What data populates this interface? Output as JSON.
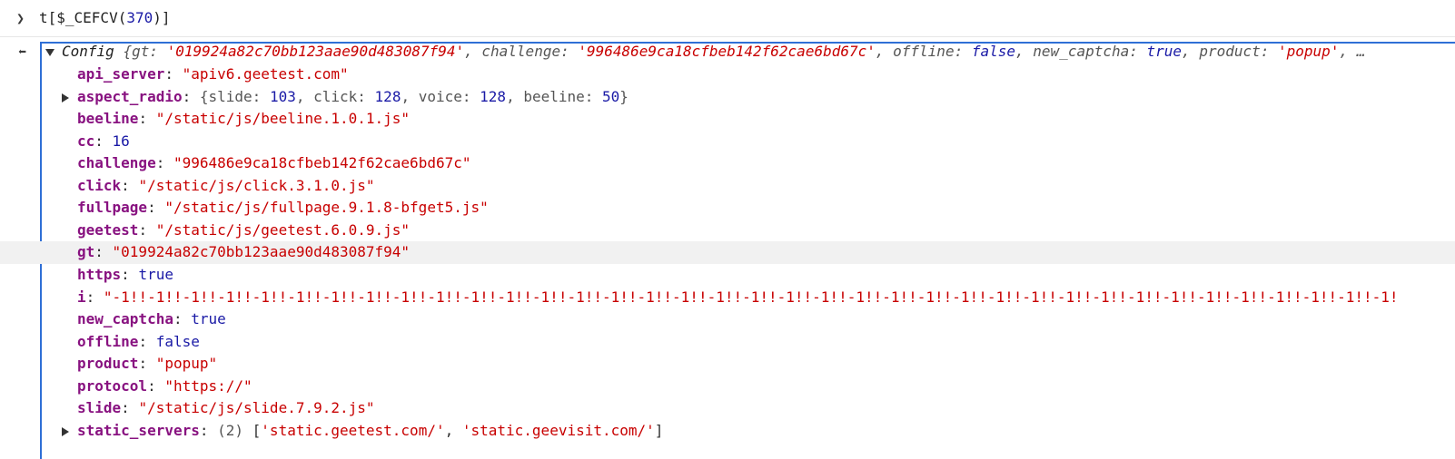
{
  "input": {
    "prompt_icon": "chevron-right-icon",
    "text_pre": "t[$_CEFCV(",
    "num": "370",
    "text_post": ")]"
  },
  "result": {
    "return_icon": "return-arrow-icon",
    "header": {
      "type": "Config",
      "open": "{",
      "gt_key": "gt",
      "gt_val": "'019924a82c70bb123aae90d483087f94'",
      "challenge_key": "challenge",
      "challenge_val": "'996486e9ca18cfbeb142f62cae6bd67c'",
      "offline_key": "offline",
      "offline_val": "false",
      "new_captcha_key": "new_captcha",
      "new_captcha_val": "true",
      "product_key": "product",
      "product_val": "'popup'",
      "ellipsis": ", …"
    },
    "props": [
      {
        "key": "api_server",
        "val": "\"apiv6.geetest.com\"",
        "kind": "str"
      },
      {
        "key": "aspect_radio",
        "kind": "obj",
        "expandable": true,
        "parts": [
          "slide",
          "103",
          "click",
          "128",
          "voice",
          "128",
          "beeline",
          "50"
        ]
      },
      {
        "key": "beeline",
        "val": "\"/static/js/beeline.1.0.1.js\"",
        "kind": "str"
      },
      {
        "key": "cc",
        "val": "16",
        "kind": "num"
      },
      {
        "key": "challenge",
        "val": "\"996486e9ca18cfbeb142f62cae6bd67c\"",
        "kind": "str"
      },
      {
        "key": "click",
        "val": "\"/static/js/click.3.1.0.js\"",
        "kind": "str"
      },
      {
        "key": "fullpage",
        "val": "\"/static/js/fullpage.9.1.8-bfget5.js\"",
        "kind": "str"
      },
      {
        "key": "geetest",
        "val": "\"/static/js/geetest.6.0.9.js\"",
        "kind": "str"
      },
      {
        "key": "gt",
        "val": "\"019924a82c70bb123aae90d483087f94\"",
        "kind": "str",
        "highlight": true
      },
      {
        "key": "https",
        "val": "true",
        "kind": "bool"
      },
      {
        "key": "i",
        "val": "\"-1!!-1!!-1!!-1!!-1!!-1!!-1!!-1!!-1!!-1!!-1!!-1!!-1!!-1!!-1!!-1!!-1!!-1!!-1!!-1!!-1!!-1!!-1!!-1!!-1!!-1!!-1!!-1!!-1!!-1!!-1!!-1!!-1!!-1!!-1!!-1!!-1!",
        "kind": "str"
      },
      {
        "key": "new_captcha",
        "val": "true",
        "kind": "bool"
      },
      {
        "key": "offline",
        "val": "false",
        "kind": "bool"
      },
      {
        "key": "product",
        "val": "\"popup\"",
        "kind": "str"
      },
      {
        "key": "protocol",
        "val": "\"https://\"",
        "kind": "str"
      },
      {
        "key": "slide",
        "val": "\"/static/js/slide.7.9.2.js\"",
        "kind": "str"
      },
      {
        "key": "static_servers",
        "kind": "arr",
        "expandable": true,
        "count": "(2)",
        "items": [
          "'static.geetest.com/'",
          "'static.geevisit.com/'"
        ]
      }
    ]
  }
}
